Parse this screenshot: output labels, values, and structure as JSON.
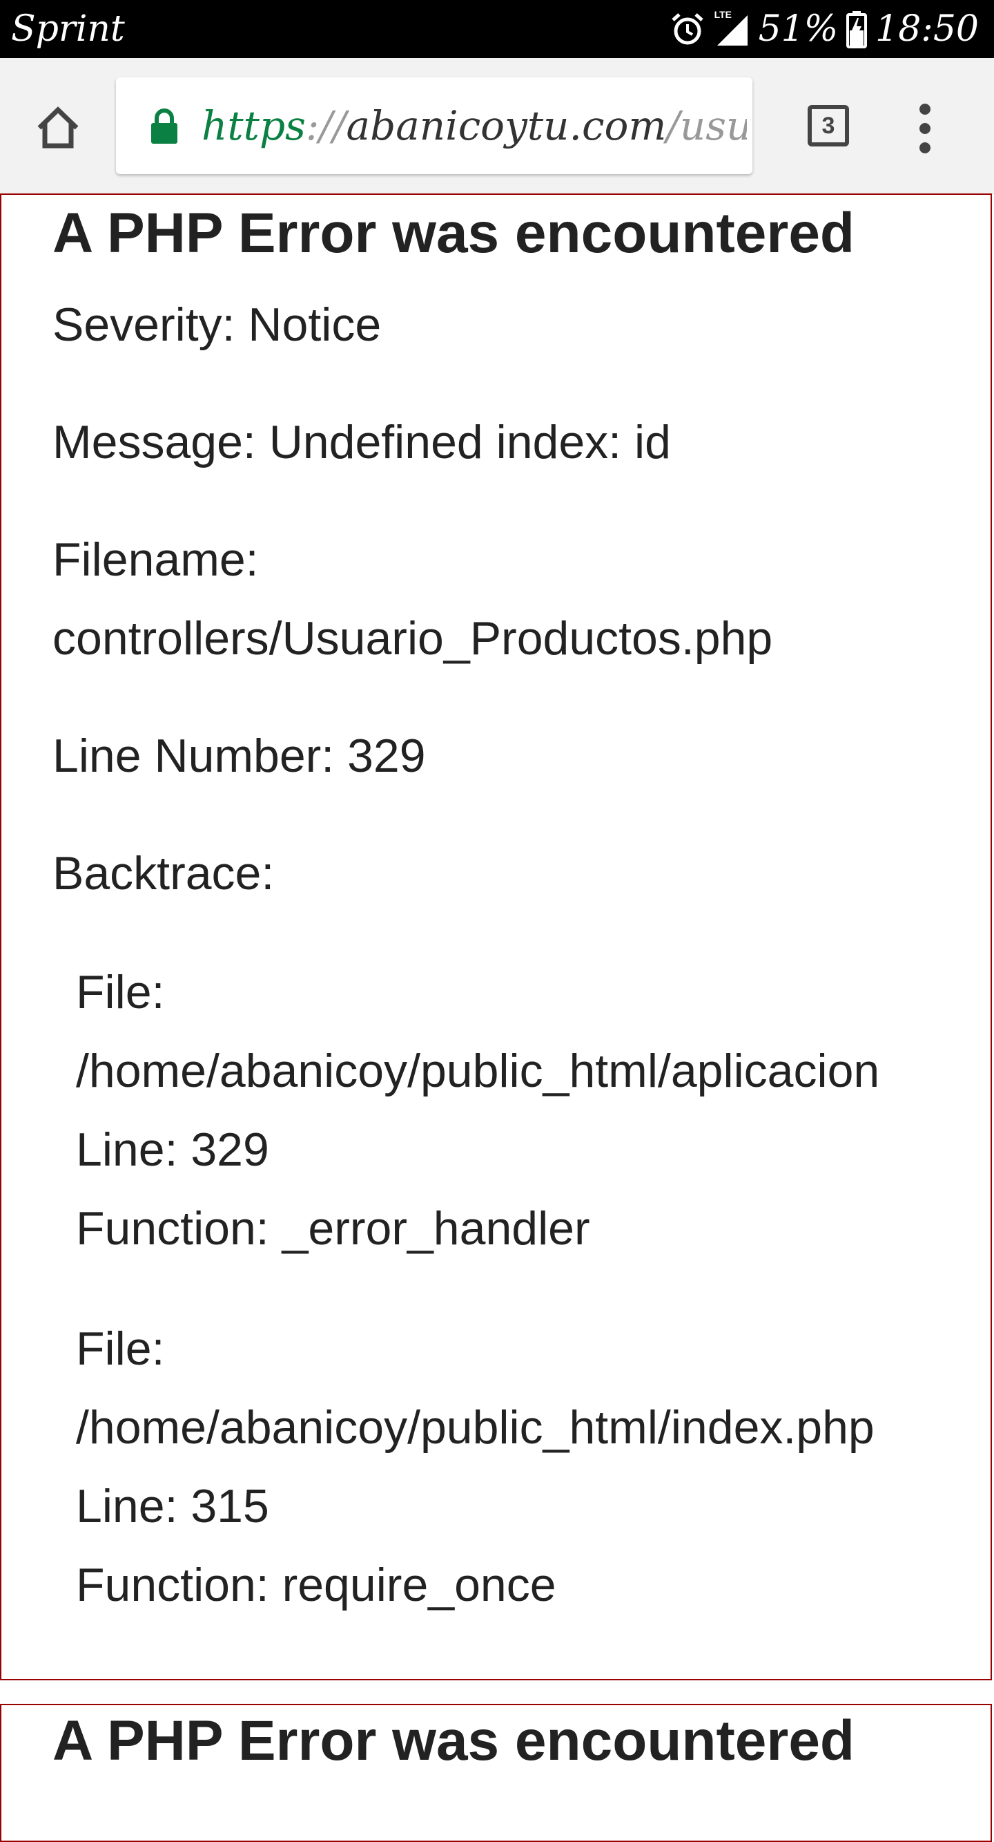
{
  "status_bar": {
    "carrier": "Sprint",
    "network_type": "LTE",
    "battery": "51%",
    "time": "18:50",
    "icons": [
      "alarm-icon",
      "signal-icon",
      "battery-icon"
    ]
  },
  "toolbar": {
    "url": {
      "scheme": "https",
      "separator": "://",
      "host": "abanicoytu.com",
      "path": "/usu"
    },
    "tab_count": "3",
    "icons": [
      "home-icon",
      "lock-icon",
      "overflow-menu-icon"
    ]
  },
  "colors": {
    "status_bar_bg": "#000000",
    "toolbar_bg": "#f2f2f2",
    "secure_green": "#0b8043",
    "error_border": "#990000",
    "text": "#222222"
  },
  "errors": [
    {
      "title": "A PHP Error was encountered",
      "severity": "Severity: Notice",
      "message": "Message: Undefined index: id",
      "filename_label": "Filename:",
      "filename_value": "controllers/Usuario_Productos.php",
      "line_number": "Line Number: 329",
      "backtrace_label": "Backtrace:",
      "backtrace": [
        {
          "file_label": "File:",
          "file_value": "/home/abanicoy/public_html/aplicacion",
          "line": "Line: 329",
          "function": "Function: _error_handler"
        },
        {
          "file_label": "File:",
          "file_value": "/home/abanicoy/public_html/index.php",
          "line": "Line: 315",
          "function": "Function: require_once"
        }
      ]
    },
    {
      "title": "A PHP Error was encountered"
    }
  ]
}
